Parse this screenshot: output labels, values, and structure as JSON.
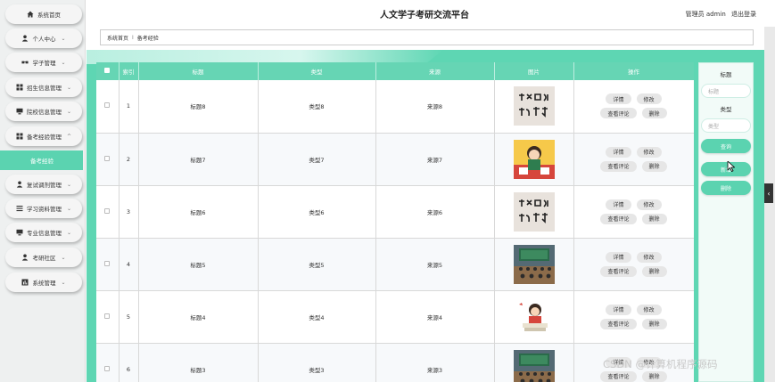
{
  "app": {
    "title": "人文学子考研交流平台"
  },
  "header": {
    "user_label": "管理员 admin",
    "logout": "退出登录"
  },
  "sidebar": {
    "items": [
      {
        "label": "系统首页",
        "icon": "home-icon",
        "chevron": ""
      },
      {
        "label": "个人中心",
        "icon": "user-icon",
        "chevron": "⌄"
      },
      {
        "label": "学子管理",
        "icon": "glasses-icon",
        "chevron": "⌄"
      },
      {
        "label": "招生信息管理",
        "icon": "grid-icon",
        "chevron": "⌄"
      },
      {
        "label": "院校信息管理",
        "icon": "monitor-icon",
        "chevron": "⌄"
      },
      {
        "label": "备考经验管理",
        "icon": "grid-icon",
        "chevron": "^"
      },
      {
        "label": "复试调剂管理",
        "icon": "user-icon",
        "chevron": "⌄"
      },
      {
        "label": "学习资料管理",
        "icon": "list-icon",
        "chevron": "⌄"
      },
      {
        "label": "专业信息管理",
        "icon": "monitor-icon",
        "chevron": "⌄"
      },
      {
        "label": "考研社区",
        "icon": "user-icon",
        "chevron": "⌄"
      },
      {
        "label": "系统管理",
        "icon": "chart-icon",
        "chevron": "⌄"
      }
    ],
    "active_sub": "备考经验"
  },
  "breadcrumb": {
    "home": "系统首页",
    "sep": "I",
    "current": "备考经验"
  },
  "table": {
    "headers": [
      "",
      "索引",
      "标题",
      "类型",
      "来源",
      "图片",
      "操作"
    ],
    "rows": [
      {
        "index": "1",
        "title": "标题8",
        "type": "类型8",
        "source": "来源8",
        "image": "calligraphy"
      },
      {
        "index": "2",
        "title": "标题7",
        "type": "类型7",
        "source": "来源7",
        "image": "cartoon-girl"
      },
      {
        "index": "3",
        "title": "标题6",
        "type": "类型6",
        "source": "来源6",
        "image": "calligraphy"
      },
      {
        "index": "4",
        "title": "标题5",
        "type": "类型5",
        "source": "来源5",
        "image": "classroom"
      },
      {
        "index": "5",
        "title": "标题4",
        "type": "类型4",
        "source": "来源4",
        "image": "study-girl"
      },
      {
        "index": "6",
        "title": "标题3",
        "type": "类型3",
        "source": "来源3",
        "image": "classroom"
      }
    ],
    "actions": {
      "detail": "详情",
      "edit": "修改",
      "comments": "查看评论",
      "delete": "删除"
    }
  },
  "search_panel": {
    "title_label": "标题",
    "title_placeholder": "标题",
    "type_label": "类型",
    "type_placeholder": "类型",
    "search_button": "查询",
    "add_button": "新增",
    "delete_button": "删除"
  },
  "watermark": "CSDN @计算机程序源码",
  "scroll_handle": "‹"
}
